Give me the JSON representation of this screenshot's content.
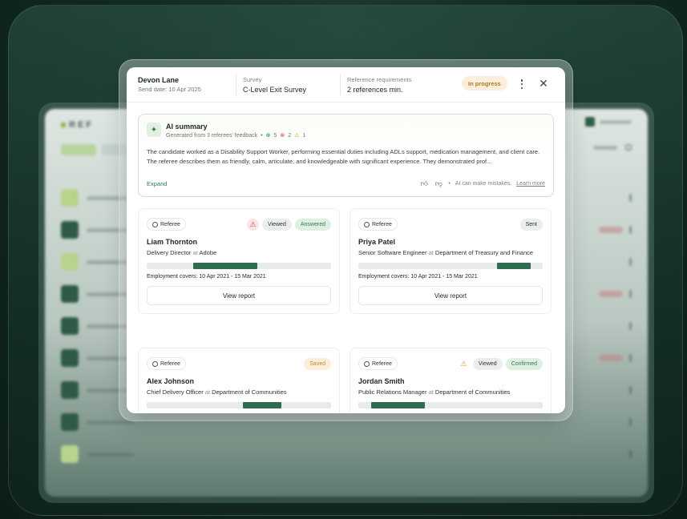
{
  "background_app": {
    "logo": "REF"
  },
  "header": {
    "candidate_name": "Devon Lane",
    "send_date": "Send date:  10 Apr 2025",
    "survey_label": "Survey",
    "survey_value": "C-Level Exit Survey",
    "requirements_label": "Reference requirements",
    "requirements_value": "2 references min.",
    "status": "In progress"
  },
  "ai_summary": {
    "title": "AI summary",
    "meta": "Generated from 3 referees' feedback",
    "positive_count": "5",
    "negative_count": "2",
    "warning_count": "1",
    "text": "The candidate worked as a Disability Support Worker, performing essential duties including ADLs support, medication management, and client care. The referee describes them as friendly, calm, articulate, and knowledgeable with significant experience. They demonstrated prof...",
    "expand_label": "Expand",
    "disclaimer": "AI can make mistakes.",
    "learn_more": "Learn more"
  },
  "referees": [
    {
      "tag": "Referee",
      "badges": [
        "Viewed",
        "Answered"
      ],
      "name": "Liam Thornton",
      "title": "Delivery Director",
      "at": "at",
      "company": "Adobe",
      "employment": "Employment covers: 10 Apr 2021 - 15 Mar 2021",
      "coverage": {
        "start": 0.25,
        "end": 0.6
      },
      "button": "View report"
    },
    {
      "tag": "Referee",
      "badges": [
        "Sent"
      ],
      "name": "Priya Patel",
      "title": "Senior Software Engineer",
      "at": "at",
      "company": "Department of Treasury and Finance",
      "employment": "Employment covers: 10 Apr 2021 - 15 Mar 2021",
      "coverage": {
        "start": 0.75,
        "end": 0.935
      },
      "button": "View report"
    },
    {
      "tag": "Referee",
      "badges": [
        "Saved"
      ],
      "name": "Alex Johnson",
      "title": "Chief Delivery Officer",
      "at": "at",
      "company": "Department of Communities",
      "coverage": {
        "start": 0.52,
        "end": 0.73
      }
    },
    {
      "tag": "Referee",
      "badges": [
        "Viewed",
        "Confirmed"
      ],
      "name": "Jordan Smith",
      "title": "Public Relations Manager",
      "at": "at",
      "company": "Department of Communities",
      "coverage": {
        "start": 0.07,
        "end": 0.36
      }
    }
  ],
  "colors": {
    "accent": "#2f6b50",
    "status_in_progress": "#b7791f",
    "answered": "#2e7d4f",
    "warning_red": "#d04545",
    "warning_amber": "#d69a1d"
  }
}
